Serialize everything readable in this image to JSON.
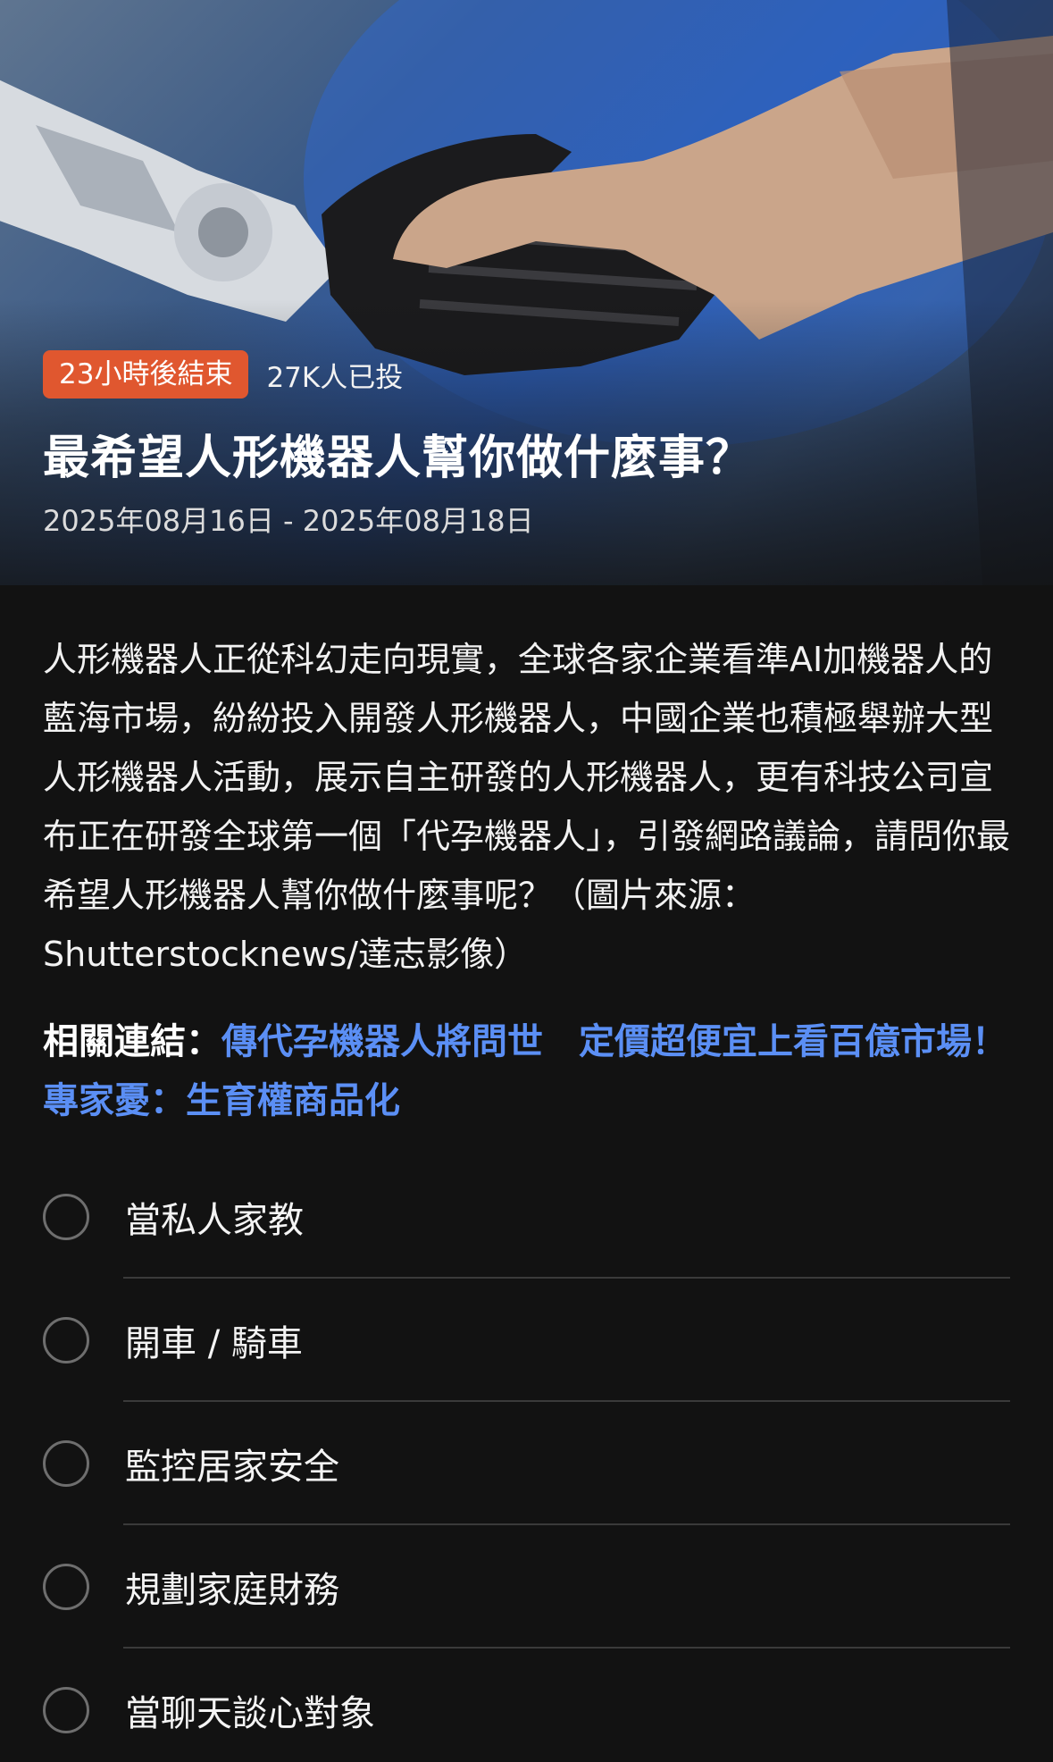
{
  "hero": {
    "badge": "23小時後結束",
    "votes": "27K人已投",
    "title": "最希望人形機器人幫你做什麼事？",
    "dates": "2025年08月16日 - 2025年08月18日"
  },
  "description": "人形機器人正從科幻走向現實，全球各家企業看準AI加機器人的藍海市場，紛紛投入開發人形機器人，中國企業也積極舉辦大型人形機器人活動，展示自主研發的人形機器人，更有科技公司宣布正在研發全球第一個「代孕機器人」，引發網路議論，請問你最希望人形機器人幫你做什麼事呢？（圖片來源：Shutterstocknews/達志影像）",
  "related": {
    "label": "相關連結：",
    "link": "傳代孕機器人將問世　定價超便宜上看百億市場！專家憂：生育權商品化"
  },
  "options": [
    {
      "label": "當私人家教"
    },
    {
      "label": "開車 / 騎車"
    },
    {
      "label": "監控居家安全"
    },
    {
      "label": "規劃家庭財務"
    },
    {
      "label": "當聊天談心對象"
    }
  ],
  "colors": {
    "badge": "#e0572f",
    "link": "#5b8ff5",
    "background": "#121212"
  }
}
